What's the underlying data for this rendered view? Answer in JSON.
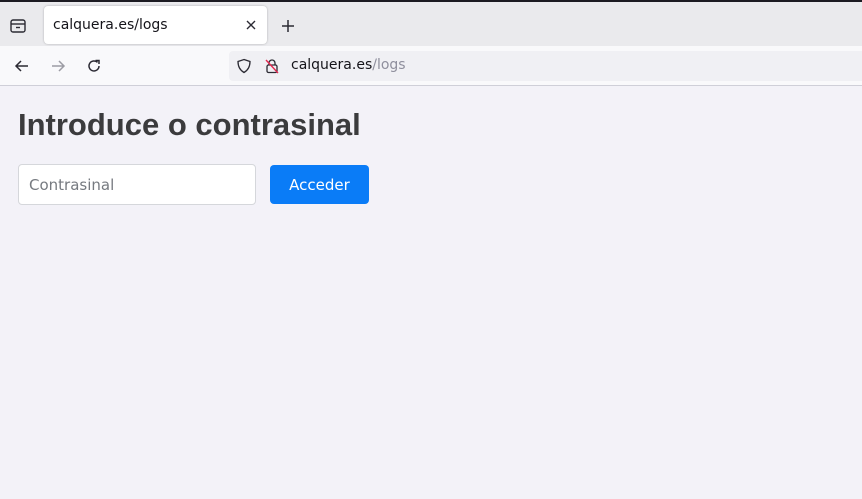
{
  "browser": {
    "tab": {
      "title": "calquera.es/logs"
    },
    "url": {
      "host": "calquera.es",
      "path": "/logs"
    },
    "icons": {
      "tab_list": "tab-list-icon",
      "close": "close-icon",
      "new_tab": "plus-icon",
      "back": "back-arrow-icon",
      "forward": "forward-arrow-icon",
      "reload": "reload-icon",
      "shield": "shield-icon",
      "lock": "insecure-lock-icon"
    }
  },
  "page": {
    "heading": "Introduce o contrasinal",
    "password": {
      "placeholder": "Contrasinal",
      "value": ""
    },
    "submit_label": "Acceder"
  },
  "colors": {
    "accent": "#0a7cf7",
    "page_background": "#f3f2f8",
    "heading": "#3b3b3d"
  }
}
